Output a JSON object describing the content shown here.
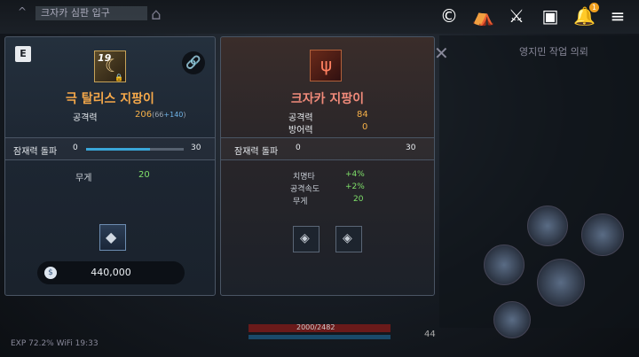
{
  "top_bar": {
    "quest_text": "크자카 심판 입구",
    "icons": [
      "currency-c-icon",
      "camp-icon",
      "crossed-swords-icon",
      "storage-icon",
      "bell-icon",
      "menu-icon"
    ],
    "notification_count": "1"
  },
  "background": {
    "right_title": "영지민 작업 의뢰",
    "hp_text": "2000/2482",
    "status_text": "EXP 72.2%   WiFi   19:33",
    "level": "44"
  },
  "left_panel": {
    "grade": "E",
    "item_level": "19",
    "item_name": "극 탈리스 지팡이",
    "stat_label": "공격력",
    "stat_value": "206",
    "stat_base": "66",
    "stat_bonus": "+140",
    "potential_label": "잠재력 돌파",
    "potential_min": "0",
    "potential_max": "30",
    "potential_fill": 0.65,
    "weight_label": "무게",
    "weight_value": "20",
    "price": "440,000"
  },
  "right_panel": {
    "item_name": "크자카 지팡이",
    "stats": [
      {
        "label": "공격력",
        "value": "84"
      },
      {
        "label": "방어력",
        "value": "0"
      }
    ],
    "potential_label": "잠재력 돌파",
    "potential_min": "0",
    "potential_max": "30",
    "substats": [
      {
        "label": "치명타",
        "value": "+4%"
      },
      {
        "label": "공격속도",
        "value": "+2%"
      },
      {
        "label": "무게",
        "value": "20"
      }
    ]
  },
  "colors": {
    "item_name_left": "#f5a84a",
    "item_name_right": "#f08a7a",
    "stat_value": "#f5b048",
    "bonus_value": "#7fe06a",
    "potential_fill": "#3aa6d8"
  }
}
